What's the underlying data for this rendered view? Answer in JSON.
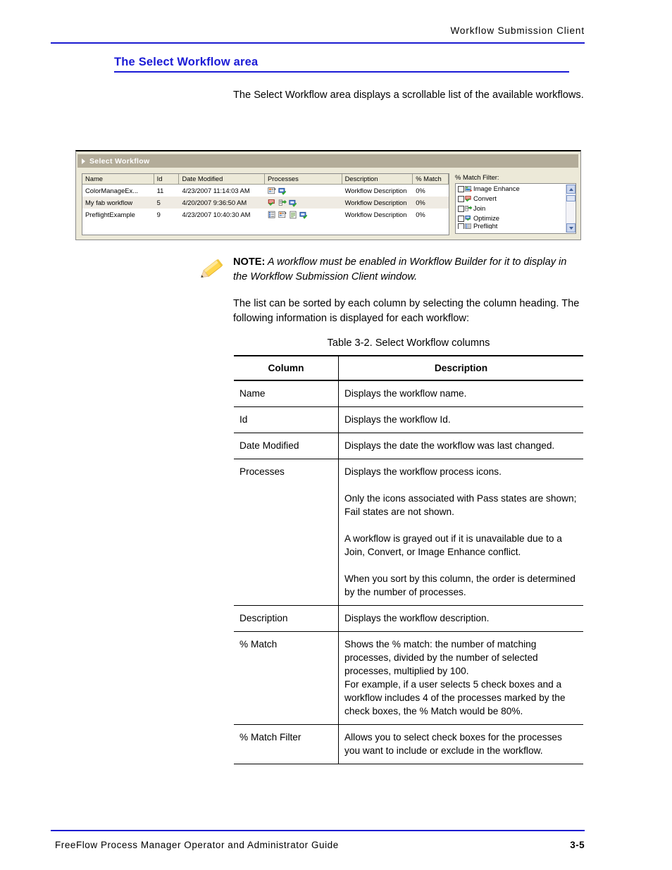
{
  "header": {
    "running_title": "Workflow Submission Client"
  },
  "heading": {
    "title": "The Select Workflow area"
  },
  "paragraphs": {
    "intro": "The Select Workflow area displays a scrollable list of the available workflows.",
    "sorted": "The list can be sorted by each column by selecting the column heading. The following information is displayed for each workflow:"
  },
  "note": {
    "label": "NOTE:",
    "text": "A workflow must be enabled in Workflow Builder for it to display in the Workflow Submission Client window.",
    "icon": "pencil-icon"
  },
  "screenshot": {
    "titlebar": {
      "label": "Select Workflow",
      "expander_icon": "triangle-right-icon"
    },
    "grid": {
      "columns": [
        "Name",
        "Id",
        "Date Modified",
        "Processes",
        "Description",
        "% Match"
      ],
      "rows": [
        {
          "name": "ColorManageEx...",
          "id": "11",
          "date_modified": "4/23/2007 11:14:03 AM",
          "process_icons": [
            "image-enhance-icon",
            "output-icon"
          ],
          "description": "Workflow Description",
          "match": "0%"
        },
        {
          "name": "My fab workflow",
          "id": "5",
          "date_modified": "4/20/2007 9:36:50 AM",
          "process_icons": [
            "convert-icon",
            "join-icon",
            "output-icon"
          ],
          "description": "Workflow Description",
          "match": "0%"
        },
        {
          "name": "PreflightExample",
          "id": "9",
          "date_modified": "4/23/2007 10:40:30 AM",
          "process_icons": [
            "preflight-icon",
            "image-enhance-icon",
            "document-icon",
            "output-icon"
          ],
          "description": "Workflow Description",
          "match": "0%"
        }
      ]
    },
    "filter": {
      "label": "% Match Filter:",
      "items": [
        {
          "label": "Image Enhance",
          "checked": false,
          "icon": "image-enhance-icon"
        },
        {
          "label": "Convert",
          "checked": false,
          "icon": "convert-icon"
        },
        {
          "label": "Join",
          "checked": false,
          "icon": "join-icon"
        },
        {
          "label": "Optimize",
          "checked": false,
          "icon": "optimize-icon"
        },
        {
          "label": "Preflight",
          "checked": false,
          "icon": "preflight-icon"
        }
      ],
      "scrollbar": {
        "up_icon": "chevron-up-icon",
        "down_icon": "chevron-down-icon"
      }
    }
  },
  "table": {
    "caption": "Table 3-2. Select Workflow columns",
    "headers": [
      "Column",
      "Description"
    ],
    "rows": [
      {
        "column": "Name",
        "description": [
          "Displays the workflow name."
        ]
      },
      {
        "column": "Id",
        "description": [
          "Displays the workflow Id."
        ]
      },
      {
        "column": "Date Modified",
        "description": [
          "Displays the date the workflow was last changed."
        ]
      },
      {
        "column": "Processes",
        "description": [
          "Displays the workflow process icons.",
          "Only the icons associated with Pass states are shown; Fail states are not shown.",
          "A workflow is grayed out if it is unavailable due to a Join, Convert, or Image Enhance conflict.",
          "When you sort by this column, the order is determined by the number of processes."
        ]
      },
      {
        "column": "Description",
        "description": [
          "Displays the workflow description."
        ]
      },
      {
        "column": "% Match",
        "description": [
          "Shows the % match: the number of matching processes, divided by the number of selected processes, multiplied by 100.",
          "For example, if a user selects 5 check boxes and a workflow includes 4 of the processes marked by the check boxes, the % Match would be 80%."
        ]
      },
      {
        "column": "% Match Filter",
        "description": [
          "Allows you to select check boxes for the processes you want to include or exclude in the workflow."
        ]
      }
    ]
  },
  "footer": {
    "guide_title": "FreeFlow Process Manager Operator and Administrator Guide",
    "page_number": "3-5"
  },
  "colors": {
    "accent_blue": "#1a1ad6",
    "rule_blue": "#1a1ad0",
    "titlebar_tan": "#b3ac99",
    "panel_beige": "#ece9d8",
    "alt_row": "#efebe3"
  }
}
